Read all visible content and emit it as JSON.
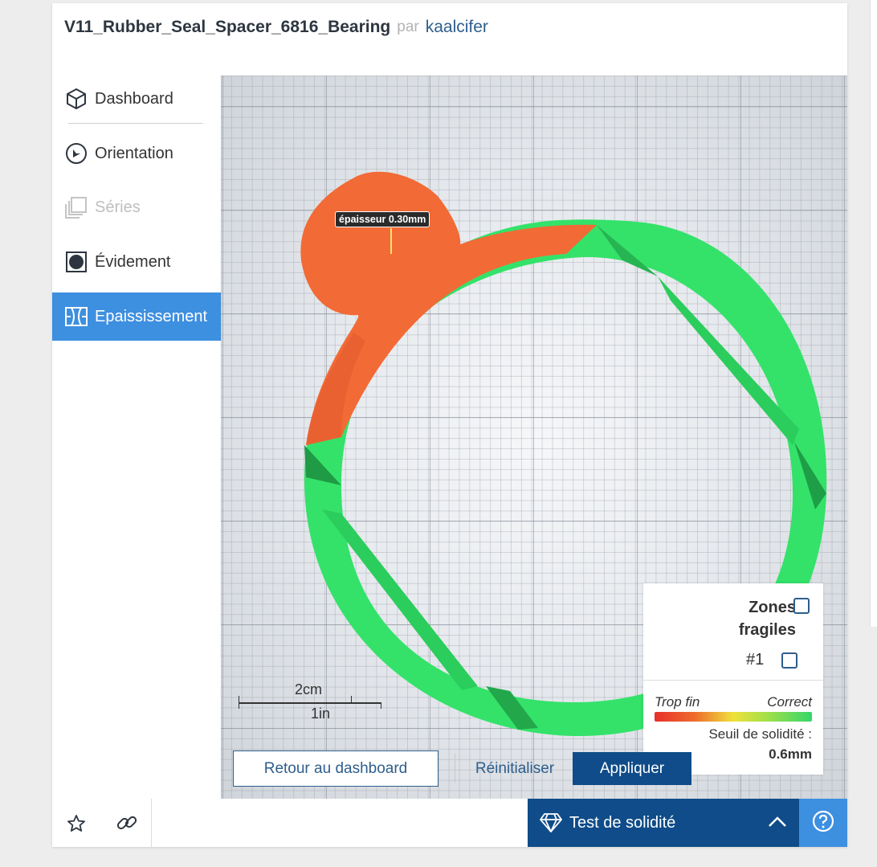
{
  "header": {
    "title": "V11_Rubber_Seal_Spacer_6816_Bearing",
    "by": "par",
    "author": "kaalcifer"
  },
  "sidebar": {
    "items": [
      {
        "label": "Dashboard",
        "icon": "cube-icon",
        "state": "normal"
      },
      {
        "label": "Orientation",
        "icon": "orientation-icon",
        "state": "normal"
      },
      {
        "label": "Séries",
        "icon": "series-icon",
        "state": "disabled"
      },
      {
        "label": "Évidement",
        "icon": "hollow-icon",
        "state": "normal"
      },
      {
        "label": "Epaississement",
        "icon": "thicken-icon",
        "state": "active"
      }
    ]
  },
  "viewport": {
    "thickness_tooltip": "épaisseur 0.30mm",
    "scale": {
      "metric": "2cm",
      "imperial": "1in"
    }
  },
  "legend": {
    "zones_label": "Zones fragiles",
    "zones_checked": false,
    "zone_item": "#1",
    "zone_item_checked": false,
    "scale_min_label": "Trop fin",
    "scale_max_label": "Correct",
    "threshold_label": "Seuil de solidité :",
    "threshold_value": "0.6mm",
    "colors": {
      "thin": "#e8302a",
      "mid": "#efe13a",
      "ok": "#33d66a"
    }
  },
  "actions": {
    "back": "Retour au dashboard",
    "reset": "Réinitialiser",
    "apply": "Appliquer"
  },
  "bottom": {
    "test_label": "Test de solidité"
  },
  "colors": {
    "accent": "#3d8fe0",
    "primary_dark": "#0f4c89",
    "link": "#2e5e8c"
  }
}
